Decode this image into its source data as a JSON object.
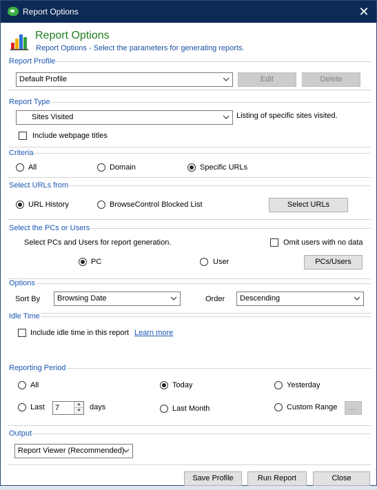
{
  "window": {
    "title": "Report Options",
    "close_icon": "close-icon"
  },
  "header": {
    "title": "Report Options",
    "subtitle": "Report Options - Select the parameters for generating reports."
  },
  "report_profile": {
    "label": "Report Profile",
    "selected": "Default Profile",
    "edit_label": "Edit",
    "delete_label": "Delete"
  },
  "report_type": {
    "label": "Report Type",
    "selected": "Sites Visited",
    "description": "Listing of specific sites visited.",
    "include_titles_label": "Include webpage titles",
    "include_titles_checked": false
  },
  "criteria": {
    "label": "Criteria",
    "options": [
      "All",
      "Domain",
      "Specific URLs"
    ],
    "selected": "Specific URLs"
  },
  "select_urls_from": {
    "label": "Select URLs from",
    "options": [
      "URL History",
      "BrowseControl Blocked List"
    ],
    "selected": "URL History",
    "button_label": "Select URLs"
  },
  "pcs_users": {
    "label": "Select the PCs or Users",
    "instruction": "Select PCs and Users for report generation.",
    "omit_label": "Omit users with no data",
    "omit_checked": false,
    "options": [
      "PC",
      "User"
    ],
    "selected": "PC",
    "button_label": "PCs/Users"
  },
  "options": {
    "label": "Options",
    "sort_by_label": "Sort By",
    "sort_by_value": "Browsing Date",
    "order_label": "Order",
    "order_value": "Descending"
  },
  "idle_time": {
    "label": "Idle Time",
    "include_label": "Include idle time in this report",
    "include_checked": false,
    "learn_more": "Learn more"
  },
  "reporting_period": {
    "label": "Reporting Period",
    "all_label": "All",
    "today_label": "Today",
    "yesterday_label": "Yesterday",
    "last_label": "Last",
    "last_value": "7",
    "days_label": "days",
    "last_month_label": "Last Month",
    "custom_range_label": "Custom Range",
    "custom_button": "...",
    "selected": "Today"
  },
  "output": {
    "label": "Output",
    "selected": "Report Viewer (Recommended)"
  },
  "footer": {
    "save_profile": "Save Profile",
    "run_report": "Run Report",
    "close": "Close"
  }
}
